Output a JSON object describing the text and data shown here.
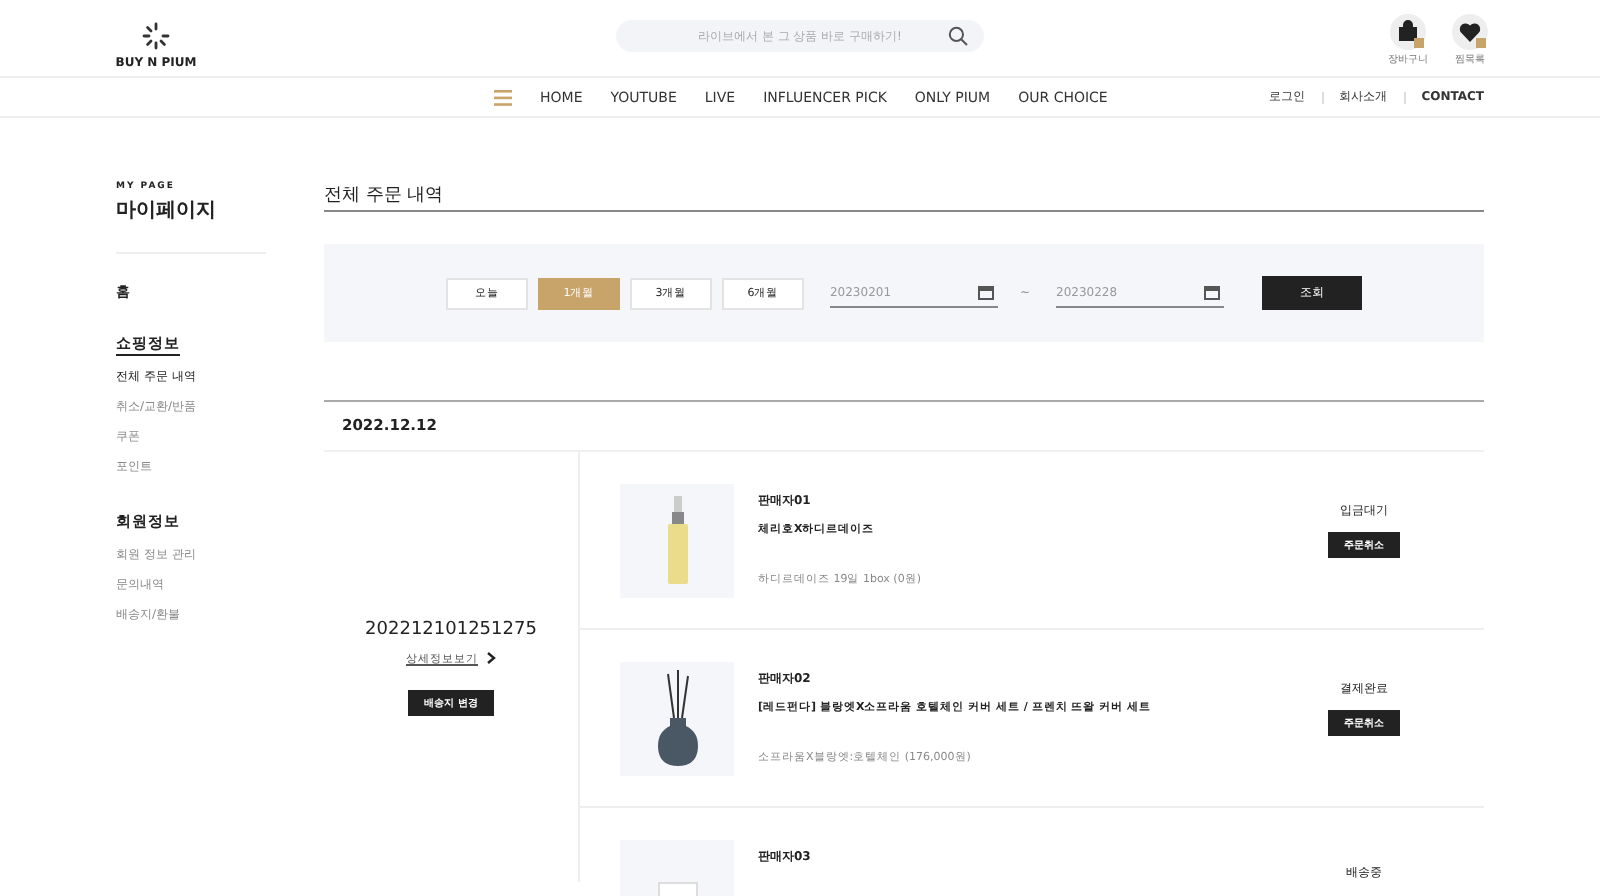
{
  "header": {
    "logo": "BUY N PIUM",
    "search": {
      "placeholder": "라이브에서 본 그 상품 바로 구매하기!"
    },
    "icons": [
      {
        "kind": "cart",
        "label": "장바구니"
      },
      {
        "kind": "heart",
        "label": "찜목록"
      }
    ]
  },
  "nav": {
    "items": [
      "HOME",
      "YOUTUBE",
      "LIVE",
      "INFLUENCER PICK",
      "ONLY PIUM",
      "OUR CHOICE"
    ],
    "links": [
      "로그인",
      "회사소개",
      "CONTACT"
    ]
  },
  "sidebar": {
    "caption": "MY PAGE",
    "title": "마이페이지",
    "home": "홈",
    "sections": [
      {
        "title": "쇼핑정보",
        "underlined": true,
        "items": [
          {
            "label": "전체 주문 내역",
            "selected": true
          },
          {
            "label": "취소/교환/반품",
            "selected": false
          },
          {
            "label": "쿠폰",
            "selected": false
          },
          {
            "label": "포인트",
            "selected": false
          }
        ]
      },
      {
        "title": "회원정보",
        "underlined": false,
        "items": [
          {
            "label": "회원 정보 관리",
            "selected": false
          },
          {
            "label": "문의내역",
            "selected": false
          },
          {
            "label": "배송지/환불",
            "selected": false
          }
        ]
      }
    ]
  },
  "page_title": "전체 주문 내역",
  "filter": {
    "periods": [
      {
        "label": "오늘",
        "selected": false
      },
      {
        "label": "1개월",
        "selected": true
      },
      {
        "label": "3개월",
        "selected": false
      },
      {
        "label": "6개월",
        "selected": false
      }
    ],
    "date_from": "20230201",
    "separator": "~",
    "date_to": "20230228",
    "search_button": "조회"
  },
  "order": {
    "date": "2022.12.12",
    "number": "202212101251275",
    "detail_link": "상세정보보기",
    "address_button": "배송지 변경",
    "items": [
      {
        "seller": "판매자01",
        "name": "체리호X하디르데이즈",
        "option": "하디르데이즈 19일 1box (0원)",
        "status": "입금대기",
        "cancel_button": "주문취소",
        "kind": "bottle"
      },
      {
        "seller": "판매자02",
        "name": "[레드펀다] 블랑엣X소프라움 호텔체인 커버 세트 / 프렌치 뜨왈 커버 세트",
        "option": "소프라움X블랑엣:호텔체인 (176,000원)",
        "status": "결제완료",
        "cancel_button": "주문취소",
        "kind": "diffuser"
      },
      {
        "seller": "판매자03",
        "status": "배송중",
        "kind": "tube"
      }
    ]
  }
}
